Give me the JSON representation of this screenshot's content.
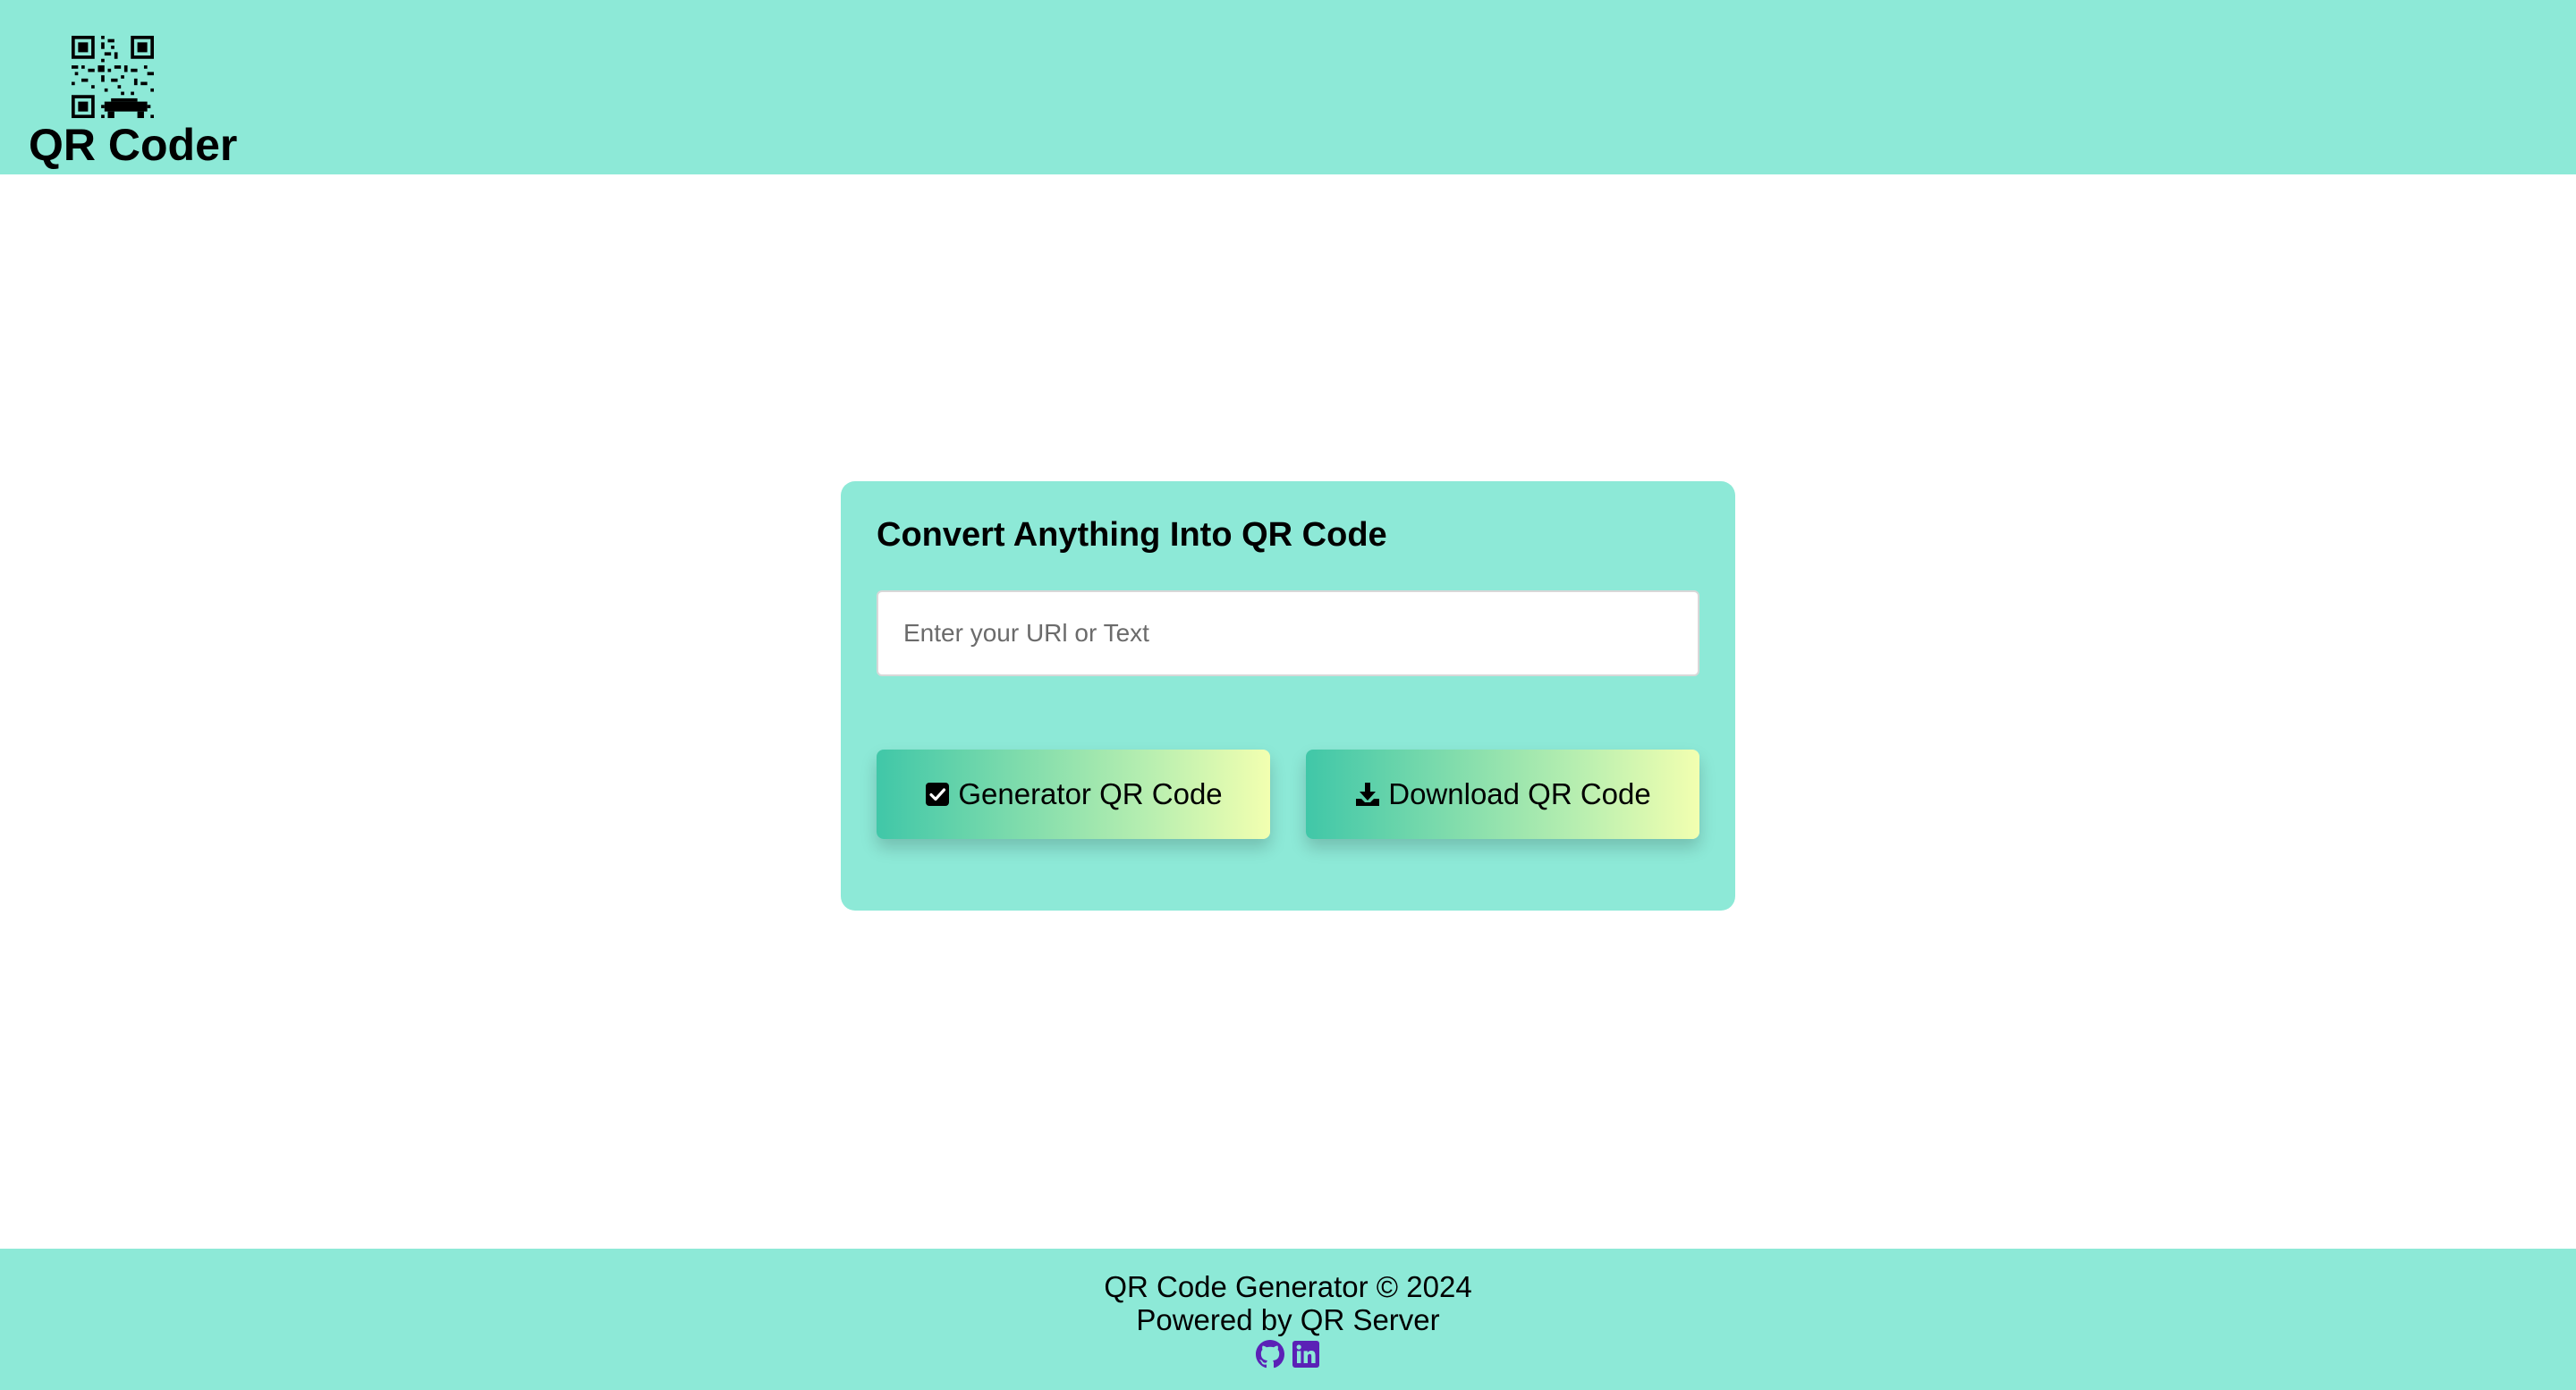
{
  "header": {
    "brand": "QR Coder",
    "logo_icon": "qr-code-icon"
  },
  "card": {
    "title": "Convert Anything Into QR Code",
    "input": {
      "placeholder": "Enter your URl or Text",
      "value": ""
    },
    "generate_button": {
      "label": "Generator QR Code",
      "icon": "check-square-icon"
    },
    "download_button": {
      "label": "Download QR Code",
      "icon": "download-icon"
    }
  },
  "footer": {
    "copyright": "QR Code Generator © 2024",
    "powered_by": "Powered by QR Server",
    "social_icons": [
      "github-icon",
      "linkedin-icon"
    ]
  },
  "colors": {
    "header_bg": "#8de9d7",
    "card_bg": "#8de9d7",
    "footer_bg": "#8de9d7",
    "button_gradient_start": "#40c7a8",
    "button_gradient_end": "#f2ffb0",
    "social_icon": "#5b21b6"
  }
}
